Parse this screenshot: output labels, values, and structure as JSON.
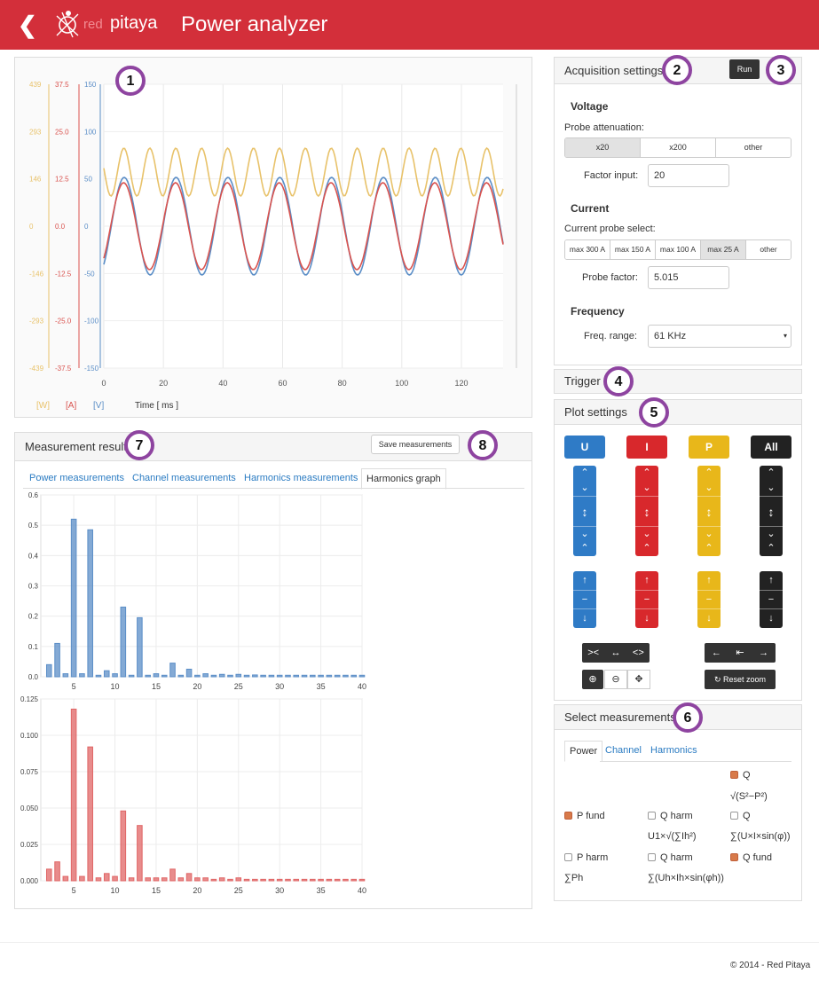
{
  "header": {
    "back_icon": "chevron-left-icon",
    "logo_word_red": "red",
    "logo_word": "pitaya",
    "title": "Power analyzer"
  },
  "badges": [
    "1",
    "2",
    "3",
    "4",
    "5",
    "6",
    "7",
    "8"
  ],
  "graph": {
    "w_ticks": [
      "439",
      "293",
      "146",
      "0",
      "-146",
      "-293",
      "-439"
    ],
    "a_ticks": [
      "37.5",
      "25.0",
      "12.5",
      "0.0",
      "-12.5",
      "-25.0",
      "-37.5"
    ],
    "v_ticks": [
      "150",
      "100",
      "50",
      "0",
      "-50",
      "-100",
      "-150"
    ],
    "x_ticks": [
      "0",
      "20",
      "40",
      "60",
      "80",
      "100",
      "120"
    ],
    "unit_w": "[W]",
    "unit_a": "[A]",
    "unit_v": "[V]",
    "time_label": "Time [ ms ]",
    "colors": {
      "w": "#e8c26a",
      "a": "#d9534f",
      "v": "#5b8ec7"
    }
  },
  "acquisition": {
    "title": "Acquisition settings",
    "run_label": "Run",
    "voltage_heading": "Voltage",
    "probe_attenuation_label": "Probe attenuation:",
    "attenuation_options": [
      "x20",
      "x200",
      "other"
    ],
    "attenuation_selected": "x20",
    "factor_input_label": "Factor input:",
    "factor_input_value": "20",
    "current_heading": "Current",
    "current_probe_label": "Current probe select:",
    "current_options": [
      "max 300 A",
      "max 150 A",
      "max 100 A",
      "max 25 A",
      "other"
    ],
    "current_selected": "max 25 A",
    "probe_factor_label": "Probe factor:",
    "probe_factor_value": "5.015",
    "frequency_heading": "Frequency",
    "freq_range_label": "Freq. range:",
    "freq_range_value": "61 KHz"
  },
  "trigger": {
    "title": "Trigger"
  },
  "plot_settings": {
    "title": "Plot settings",
    "buttons": [
      "U",
      "I",
      "P",
      "All"
    ],
    "reset_zoom_label": "Reset zoom",
    "colors": {
      "u": "#2f7bc6",
      "i": "#d8282c",
      "p": "#e8b71a",
      "all": "#222222"
    }
  },
  "select_measurements": {
    "title": "Select measurements",
    "tabs": [
      "Power",
      "Channel",
      "Harmonics"
    ],
    "active_tab": "Power",
    "items": {
      "q_sqrt": {
        "label": "Q",
        "formula": "√(S²−P²)",
        "checked": true
      },
      "p_fund": {
        "label": "P fund",
        "checked": true
      },
      "q_harm1": {
        "label": "Q harm",
        "formula": "U1×√(∑Ih²)",
        "checked": false
      },
      "q_sum": {
        "label": "Q",
        "formula": "∑(U×I×sin(φ))",
        "checked": false
      },
      "p_harm": {
        "label": "P harm",
        "formula": "∑Ph",
        "checked": false
      },
      "q_harm2": {
        "label": "Q harm",
        "formula": "∑(Uh×Ih×sin(φh))",
        "checked": false
      },
      "q_fund": {
        "label": "Q fund",
        "checked": true
      }
    }
  },
  "measurement": {
    "title": "Measurement result",
    "save_label": "Save measurements",
    "tabs": [
      "Power measurements",
      "Channel measurements",
      "Harmonics measurements",
      "Harmonics graph"
    ],
    "active_tab": "Harmonics graph"
  },
  "chart_data": [
    {
      "type": "bar",
      "color": "#5b8ec7",
      "x_ticks": [
        "5",
        "10",
        "15",
        "20",
        "25",
        "30",
        "35",
        "40"
      ],
      "y_ticks": [
        "0.6",
        "0.5",
        "0.4",
        "0.3",
        "0.2",
        "0.1",
        "0.0"
      ],
      "ylim": [
        0,
        0.6
      ],
      "xlim": [
        1,
        40
      ],
      "x": [
        2,
        3,
        4,
        5,
        6,
        7,
        8,
        9,
        10,
        11,
        12,
        13,
        14,
        15,
        16,
        17,
        18,
        19,
        20,
        21,
        22,
        23,
        24,
        25,
        26,
        27,
        28,
        29,
        30,
        31,
        32,
        33,
        34,
        35,
        36,
        37,
        38,
        39,
        40
      ],
      "values": [
        0.04,
        0.11,
        0.01,
        0.52,
        0.01,
        0.485,
        0.005,
        0.02,
        0.01,
        0.23,
        0.005,
        0.195,
        0.005,
        0.01,
        0.005,
        0.045,
        0.005,
        0.025,
        0.005,
        0.01,
        0.005,
        0.008,
        0.005,
        0.008,
        0.005,
        0.006,
        0.005,
        0.005,
        0.005,
        0.005,
        0.005,
        0.005,
        0.005,
        0.005,
        0.005,
        0.005,
        0.005,
        0.005,
        0.005
      ]
    },
    {
      "type": "bar",
      "color": "#e06666",
      "x_ticks": [
        "5",
        "10",
        "15",
        "20",
        "25",
        "30",
        "35",
        "40"
      ],
      "y_ticks": [
        "0.125",
        "0.100",
        "0.075",
        "0.050",
        "0.025",
        "0.000"
      ],
      "ylim": [
        0,
        0.125
      ],
      "xlim": [
        1,
        40
      ],
      "x": [
        2,
        3,
        4,
        5,
        6,
        7,
        8,
        9,
        10,
        11,
        12,
        13,
        14,
        15,
        16,
        17,
        18,
        19,
        20,
        21,
        22,
        23,
        24,
        25,
        26,
        27,
        28,
        29,
        30,
        31,
        32,
        33,
        34,
        35,
        36,
        37,
        38,
        39,
        40
      ],
      "values": [
        0.008,
        0.013,
        0.003,
        0.118,
        0.003,
        0.092,
        0.002,
        0.005,
        0.003,
        0.048,
        0.002,
        0.038,
        0.002,
        0.002,
        0.002,
        0.008,
        0.002,
        0.005,
        0.002,
        0.002,
        0.001,
        0.002,
        0.001,
        0.002,
        0.001,
        0.001,
        0.001,
        0.001,
        0.001,
        0.001,
        0.001,
        0.001,
        0.001,
        0.001,
        0.001,
        0.001,
        0.001,
        0.001,
        0.001
      ]
    }
  ],
  "footer": "© 2014 - Red Pitaya"
}
